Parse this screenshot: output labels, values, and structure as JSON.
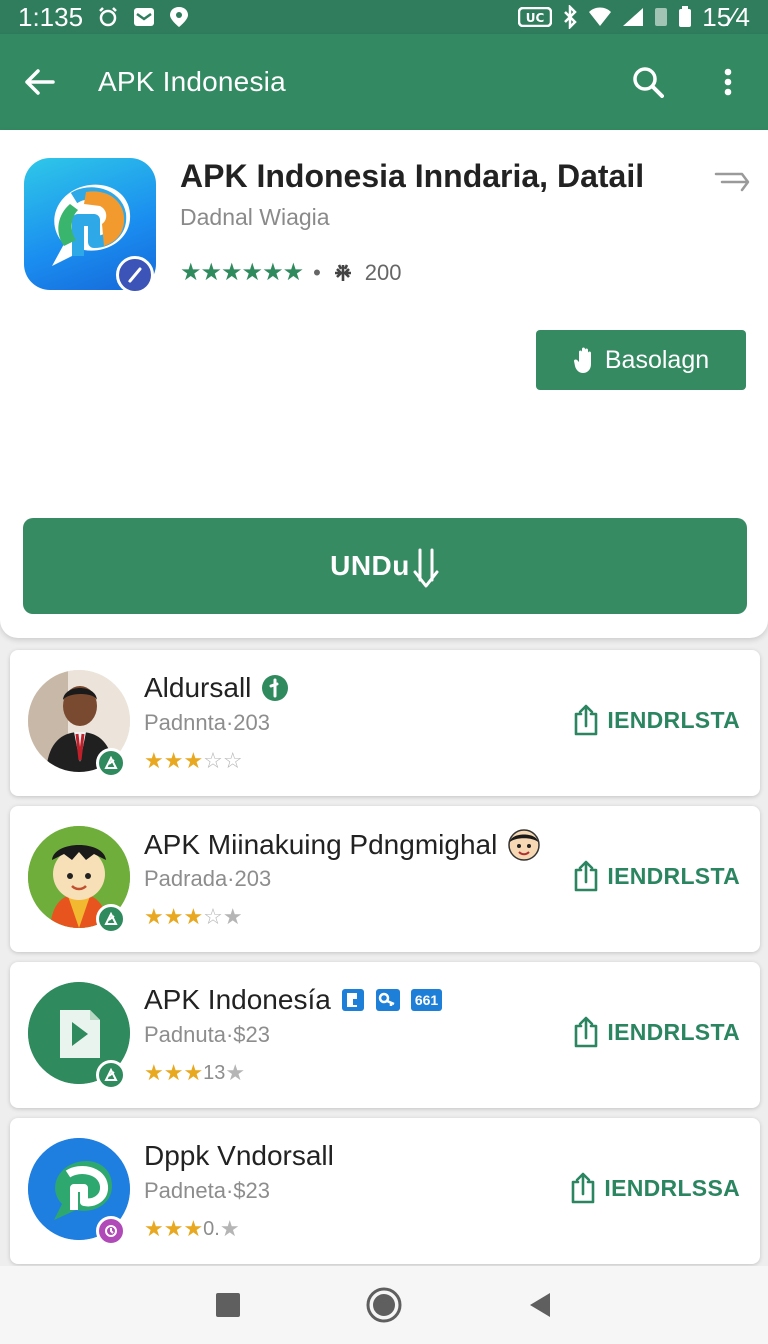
{
  "status_bar": {
    "time": "1:135",
    "battery": "15⁄4"
  },
  "app_bar": {
    "title": "APK Indonesia"
  },
  "detail": {
    "title": "APK Indonesia Inndaria, Datail",
    "developer": "Dadnal Wiagia",
    "stars": "★★★★★★",
    "separator": "•",
    "count": "200",
    "action_label": "Basolagn",
    "download_label": "UNDu"
  },
  "apps": [
    {
      "name": "Aldursall",
      "sub": "Padnnta·203",
      "stars_on": "★★★",
      "stars_off": "☆☆",
      "rating_text": "",
      "action": "IENDRLSTA",
      "badge_color": "#2f8a5e"
    },
    {
      "name": "APK Miinakuing Pdngmighal",
      "sub": "Padrada·203",
      "stars_on": "★★★",
      "stars_off": "☆★",
      "rating_text": "",
      "action": "IENDRLSTA",
      "badge_color": "#2f8a5e"
    },
    {
      "name": "APK Indonesía",
      "sub": "Padnuta·$23",
      "stars_on": "★★★",
      "stars_off": "★",
      "rating_text": "13",
      "action": "IENDRLSTA",
      "badge_color": "#2f8a5e",
      "tag_text": "661"
    },
    {
      "name": "Dppk Vndorsall",
      "sub": "Padneta·$23",
      "stars_on": "★★★",
      "stars_off": "★",
      "rating_text": " 0.",
      "action": "IENDRLSSA",
      "badge_color": "#b04ab8"
    }
  ],
  "colors": {
    "primary": "#338a62",
    "status_bar": "#2f7d5c",
    "accent_text": "#2a8560",
    "star": "#e8a820"
  },
  "icons": [
    "back-arrow-icon",
    "search-icon",
    "more-vert-icon",
    "share-icon",
    "hand-icon",
    "download-arrow-icon",
    "upload-icon",
    "nav-recents-icon",
    "nav-home-icon",
    "nav-back-icon"
  ]
}
